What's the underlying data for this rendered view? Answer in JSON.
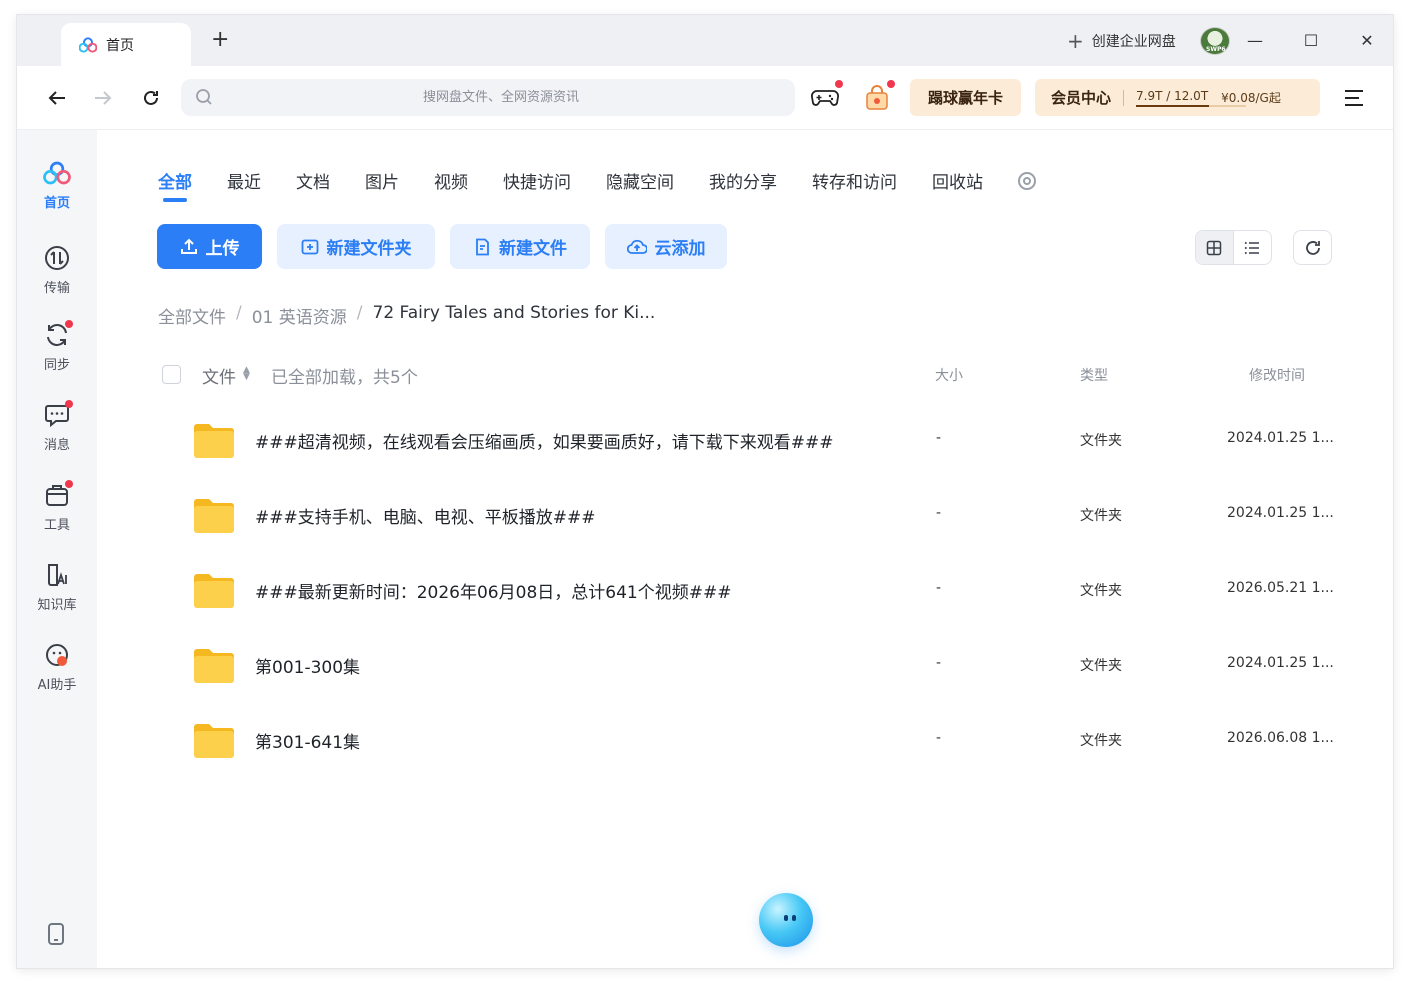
{
  "app": {
    "tab_title": "首页",
    "new_tab": "+",
    "create_enterprise": "创建企业网盘",
    "avatar_text": "SWP6"
  },
  "window_controls": {
    "minimize": "—",
    "maximize": "☐",
    "close": "✕"
  },
  "search": {
    "placeholder": "搜网盘文件、全网资源资讯"
  },
  "promo": {
    "label": "蹋球赢年卡"
  },
  "vip": {
    "title": "会员中心",
    "quota": "7.9T / 12.0T",
    "quota_used_fraction": 0.66,
    "price": "¥0.08/G起",
    "chevron": "›"
  },
  "sidebar": {
    "items": [
      {
        "label": "首页",
        "icon": "home-logo-icon",
        "active": true,
        "dot": false
      },
      {
        "label": "传输",
        "icon": "transfer-icon",
        "active": false,
        "dot": false
      },
      {
        "label": "同步",
        "icon": "sync-icon",
        "active": false,
        "dot": true
      },
      {
        "label": "消息",
        "icon": "message-icon",
        "active": false,
        "dot": true
      },
      {
        "label": "工具",
        "icon": "toolbox-icon",
        "active": false,
        "dot": true
      },
      {
        "label": "知识库",
        "icon": "knowledge-base-icon",
        "active": false,
        "dot": false
      },
      {
        "label": "AI助手",
        "icon": "ai-assistant-icon",
        "active": false,
        "dot": false
      }
    ]
  },
  "categories": [
    "全部",
    "最近",
    "文档",
    "图片",
    "视频",
    "快捷访问",
    "隐藏空间",
    "我的分享",
    "转存和访问",
    "回收站"
  ],
  "actions": {
    "upload": "上传",
    "new_folder": "新建文件夹",
    "new_file": "新建文件",
    "cloud_add": "云添加"
  },
  "breadcrumb": {
    "root": "全部文件",
    "level1": "01 英语资源",
    "current": "72 Fairy Tales and Stories for Ki...",
    "sep": "/"
  },
  "table": {
    "header": {
      "file": "文件",
      "loaded": "已全部加载，共5个",
      "size": "大小",
      "type": "类型",
      "mtime": "修改时间"
    },
    "rows": [
      {
        "name": "###超清视频，在线观看会压缩画质，如果要画质好，请下载下来观看###",
        "size": "-",
        "type": "文件夹",
        "mtime": "2024.01.25 1..."
      },
      {
        "name": "###支持手机、电脑、电视、平板播放###",
        "size": "-",
        "type": "文件夹",
        "mtime": "2024.01.25 1..."
      },
      {
        "name": "###最新更新时间：2026年06月08日，总计641个视频###",
        "size": "-",
        "type": "文件夹",
        "mtime": "2026.05.21 1..."
      },
      {
        "name": "第001-300集",
        "size": "-",
        "type": "文件夹",
        "mtime": "2024.01.25 1..."
      },
      {
        "name": "第301-641集",
        "size": "-",
        "type": "文件夹",
        "mtime": "2026.06.08 1..."
      }
    ]
  },
  "colors": {
    "accent": "#2b7ef5",
    "light_accent": "#e6f0fe",
    "promo_bg": "#fcecd7",
    "folder": "#fbc531",
    "red_dot": "#f0374d"
  }
}
